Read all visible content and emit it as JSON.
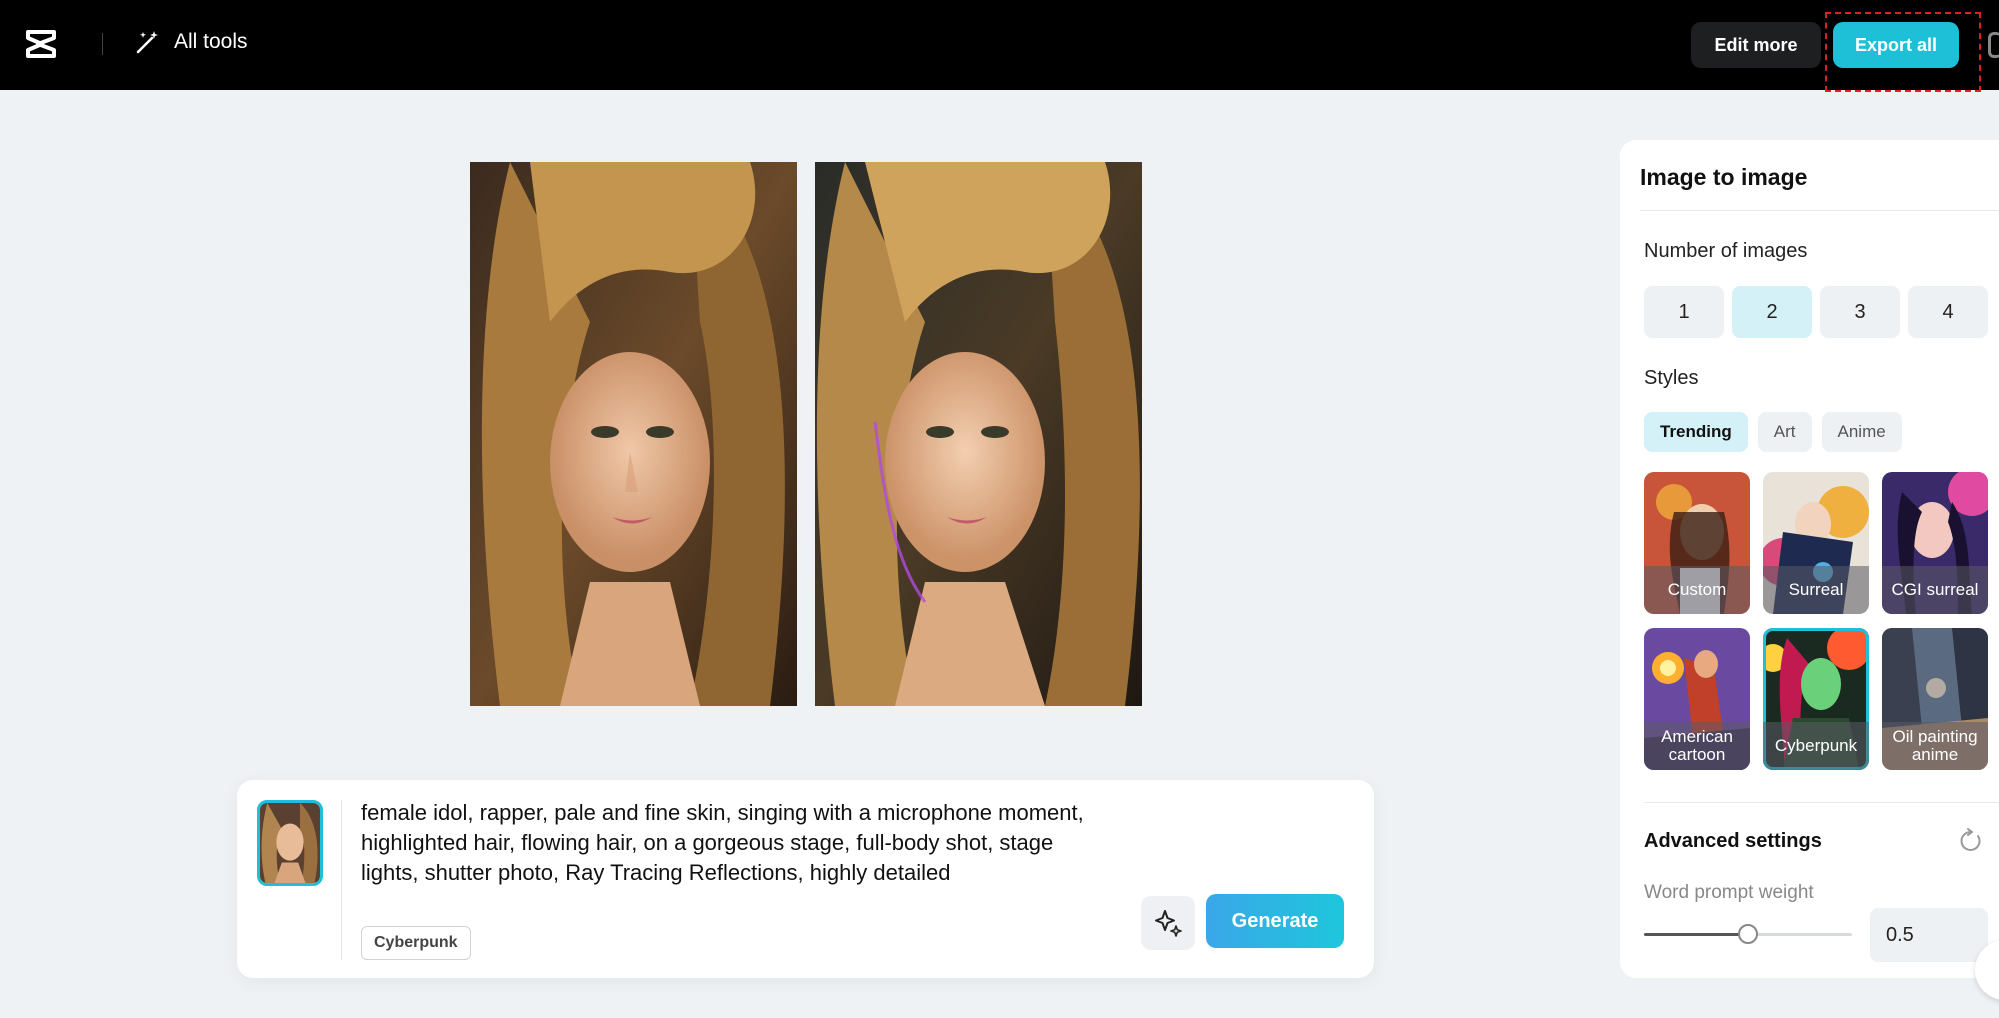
{
  "header": {
    "all_tools": "All tools",
    "edit_more": "Edit more",
    "export_all": "Export all"
  },
  "prompt": {
    "text": "female idol, rapper, pale and fine skin, singing with a microphone moment, highlighted hair, flowing hair, on a gorgeous stage, full-body shot, stage lights, shutter photo, Ray Tracing Reflections, highly detailed",
    "style_chip": "Cyberpunk",
    "generate": "Generate"
  },
  "panel": {
    "title": "Image to image",
    "number_label": "Number of images",
    "numbers": [
      "1",
      "2",
      "3",
      "4"
    ],
    "selected_number": "2",
    "styles_label": "Styles",
    "tabs": [
      "Trending",
      "Art",
      "Anime"
    ],
    "styles": [
      "Custom",
      "Surreal",
      "CGI surreal",
      "American cartoon",
      "Cyberpunk",
      "Oil painting anime"
    ],
    "selected_style": "Cyberpunk",
    "advanced_title": "Advanced settings",
    "weight_label": "Word prompt weight",
    "weight_value": "0.5",
    "weight_fraction": 0.5
  },
  "colors": {
    "accent": "#1ec0d8",
    "topbar": "#000000",
    "highlight": "#e02020"
  }
}
